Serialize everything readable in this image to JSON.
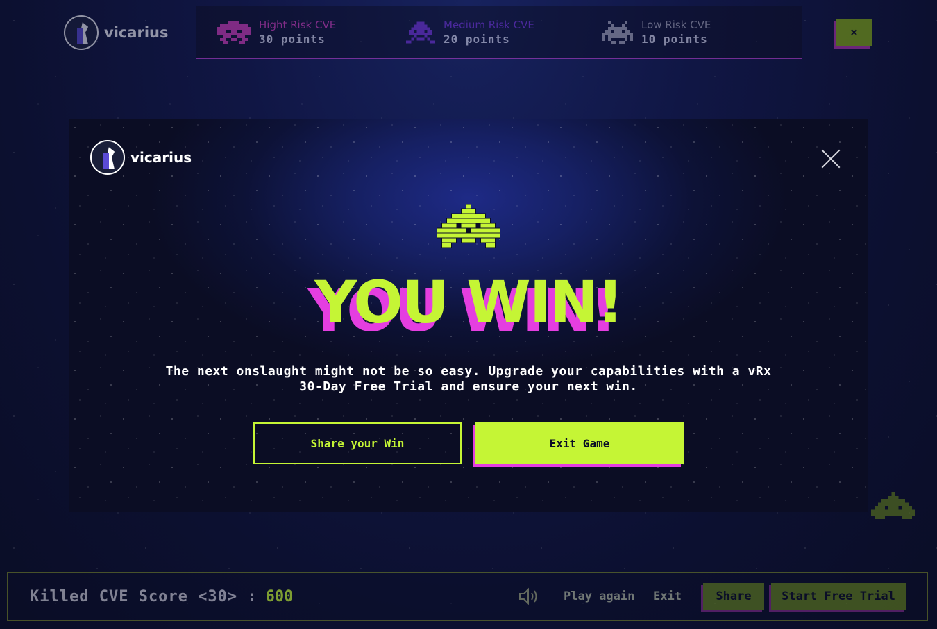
{
  "brand": {
    "name": "vicarius"
  },
  "legend": {
    "items": [
      {
        "name": "Hight Risk CVE",
        "points": "30 points",
        "color": "#c93ab0"
      },
      {
        "name": "Medium Risk CVE",
        "points": "20 points",
        "color": "#6d2fc8"
      },
      {
        "name": "Low Risk CVE",
        "points": "10 points",
        "color": "#9c9cab"
      }
    ]
  },
  "top_close_label": "×",
  "modal": {
    "title": "YOU WIN!",
    "message": "The next onslaught might not be so easy. Upgrade your capabilities with a vRx 30-Day Free Trial and ensure your next win.",
    "share_label": "Share your Win",
    "exit_label": "Exit Game"
  },
  "bottom_bar": {
    "score_label": "Killed CVE Score <30> :",
    "score_value": "600",
    "play_again": "Play again",
    "exit": "Exit",
    "share": "Share",
    "trial": "Start Free Trial"
  },
  "colors": {
    "accent_green": "#c5f535",
    "accent_pink": "#e43ee0",
    "background": "#0c1030"
  }
}
